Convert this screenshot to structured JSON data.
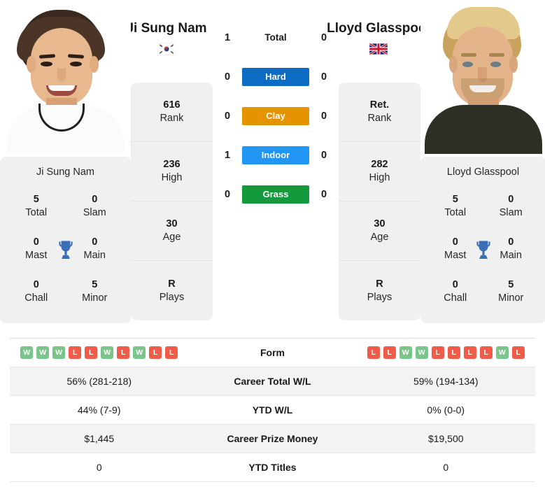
{
  "players": {
    "left": {
      "name": "Ji Sung Nam",
      "flag": "kr-flag-icon",
      "flag_label": "South Korea",
      "card_name": "Ji Sung Nam",
      "titles": {
        "total_value": "5",
        "total_label": "Total",
        "slam_value": "0",
        "slam_label": "Slam",
        "mast_value": "0",
        "mast_label": "Mast",
        "main_value": "0",
        "main_label": "Main",
        "chall_value": "0",
        "chall_label": "Chall",
        "minor_value": "5",
        "minor_label": "Minor"
      },
      "stats": [
        {
          "value": "616",
          "label": "Rank"
        },
        {
          "value": "236",
          "label": "High"
        },
        {
          "value": "30",
          "label": "Age"
        },
        {
          "value": "R",
          "label": "Plays"
        }
      ],
      "form": [
        "W",
        "W",
        "W",
        "L",
        "L",
        "W",
        "L",
        "W",
        "L",
        "L"
      ],
      "career_total_wl": "56% (281-218)",
      "ytd_wl": "44% (7-9)",
      "career_prize_money": "$1,445",
      "ytd_titles": "0"
    },
    "right": {
      "name": "Lloyd Glasspool",
      "flag": "gb-flag-icon",
      "flag_label": "United Kingdom",
      "card_name": "Lloyd Glasspool",
      "titles": {
        "total_value": "5",
        "total_label": "Total",
        "slam_value": "0",
        "slam_label": "Slam",
        "mast_value": "0",
        "mast_label": "Mast",
        "main_value": "0",
        "main_label": "Main",
        "chall_value": "0",
        "chall_label": "Chall",
        "minor_value": "5",
        "minor_label": "Minor"
      },
      "stats": [
        {
          "value": "Ret.",
          "label": "Rank"
        },
        {
          "value": "282",
          "label": "High"
        },
        {
          "value": "30",
          "label": "Age"
        },
        {
          "value": "R",
          "label": "Plays"
        }
      ],
      "form": [
        "L",
        "L",
        "W",
        "W",
        "L",
        "L",
        "L",
        "L",
        "W",
        "L"
      ],
      "career_total_wl": "59% (194-134)",
      "ytd_wl": "0% (0-0)",
      "career_prize_money": "$19,500",
      "ytd_titles": "0"
    }
  },
  "h2h": [
    {
      "surface": "Total",
      "left": "1",
      "right": "0",
      "color": "transparent"
    },
    {
      "surface": "Hard",
      "left": "0",
      "right": "0",
      "color": "#0c6cc4"
    },
    {
      "surface": "Clay",
      "left": "0",
      "right": "0",
      "color": "#e59400"
    },
    {
      "surface": "Indoor",
      "left": "1",
      "right": "0",
      "color": "#2196f3"
    },
    {
      "surface": "Grass",
      "left": "0",
      "right": "0",
      "color": "#149a3d"
    }
  ],
  "table_rows": [
    {
      "label": "Form"
    },
    {
      "label": "Career Total W/L"
    },
    {
      "label": "YTD W/L"
    },
    {
      "label": "Career Prize Money"
    },
    {
      "label": "YTD Titles"
    }
  ],
  "colors": {
    "hard": "#0c6cc4",
    "clay": "#e59400",
    "indoor": "#2196f3",
    "grass": "#149a3d",
    "win": "#7ac58a",
    "loss": "#f15c4a",
    "trophy": "#3b6fb5",
    "card_bg": "#f0f0f0"
  }
}
